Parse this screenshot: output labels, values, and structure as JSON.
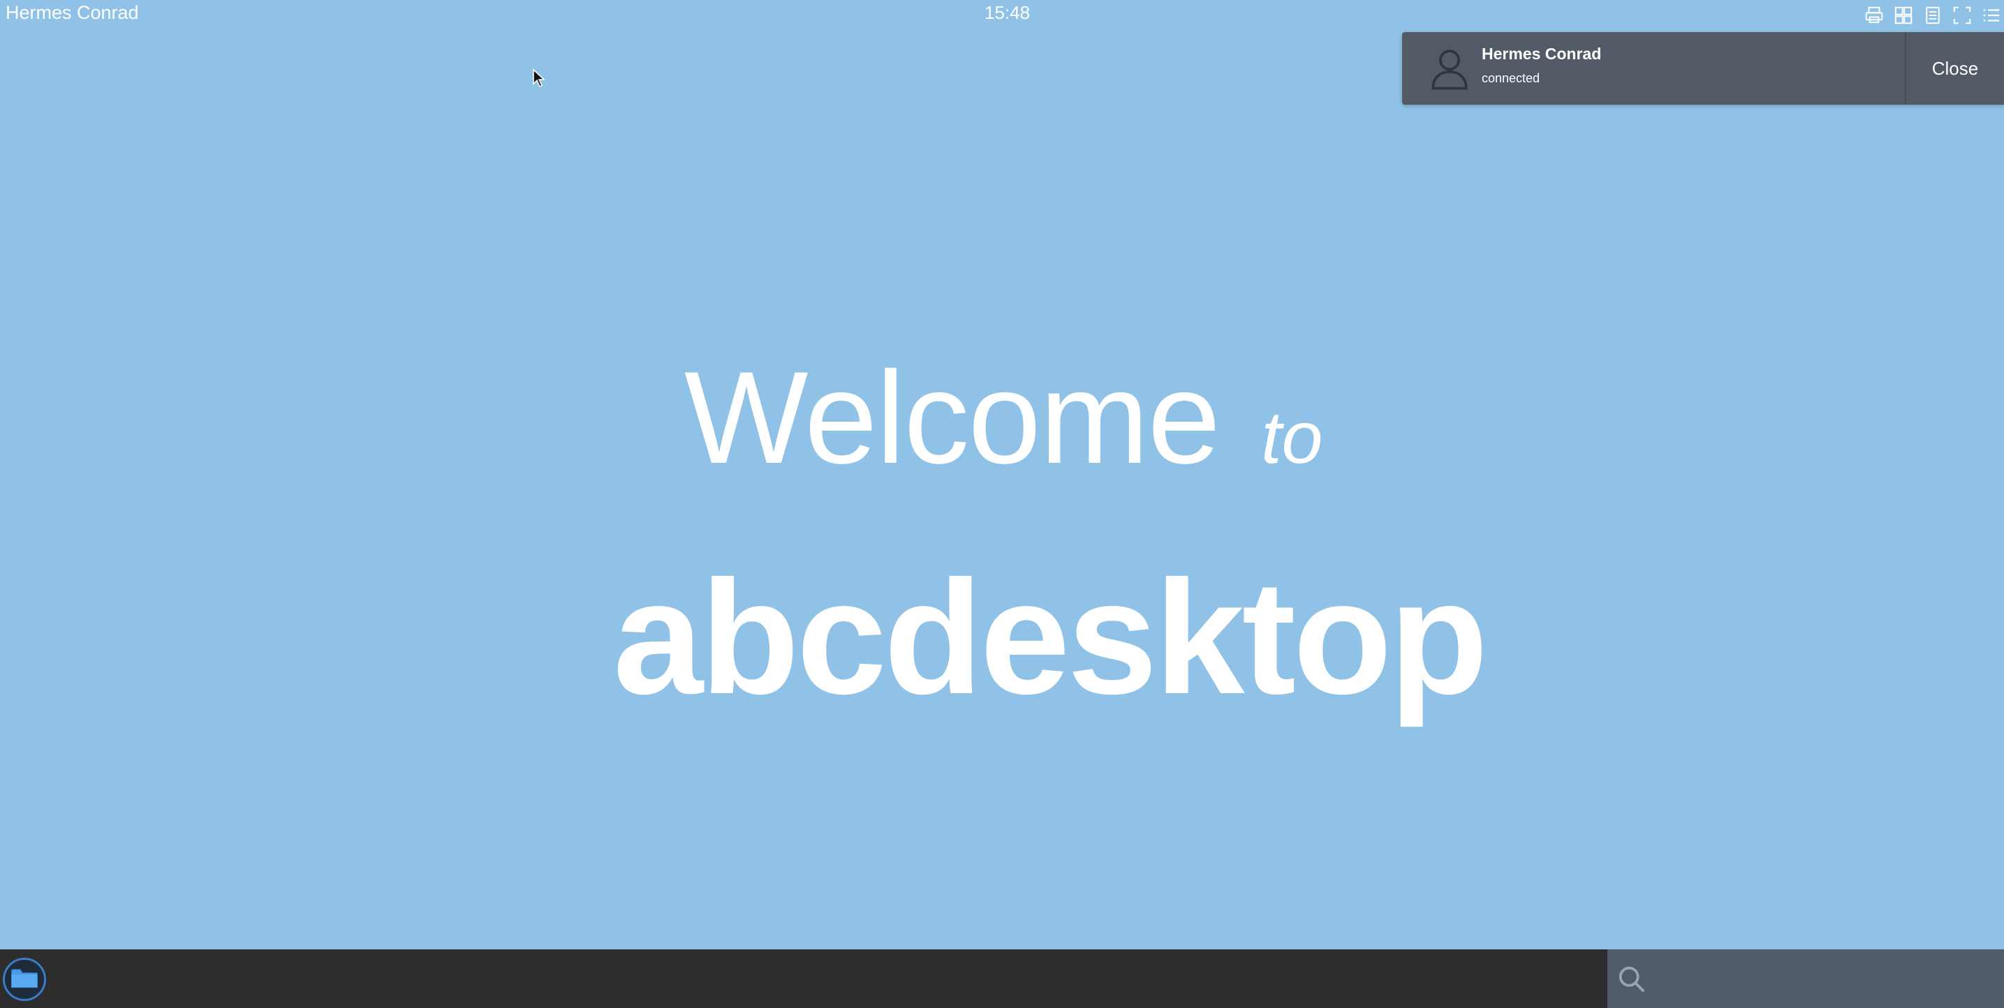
{
  "topbar": {
    "user_name": "Hermes Conrad",
    "clock": "15:48",
    "icons": [
      "printer-icon",
      "apps-grid-icon",
      "clipboard-icon",
      "fullscreen-icon",
      "menu-list-icon"
    ]
  },
  "notification": {
    "title": "Hermes Conrad",
    "subtitle": "connected",
    "close_label": "Close"
  },
  "welcome": {
    "line1": "Welcome",
    "line1_small": "to",
    "line2": "abcdesktop"
  },
  "taskbar": {
    "dock_items": [
      "folder-icon"
    ],
    "search": {
      "value": "",
      "placeholder": ""
    }
  },
  "colors": {
    "desktop_bg": "#8fc2e6",
    "taskbar_bg": "#2d2d2d",
    "notification_bg": "#525a66",
    "search_bg": "#505a68",
    "accent": "#3b7cc9"
  }
}
